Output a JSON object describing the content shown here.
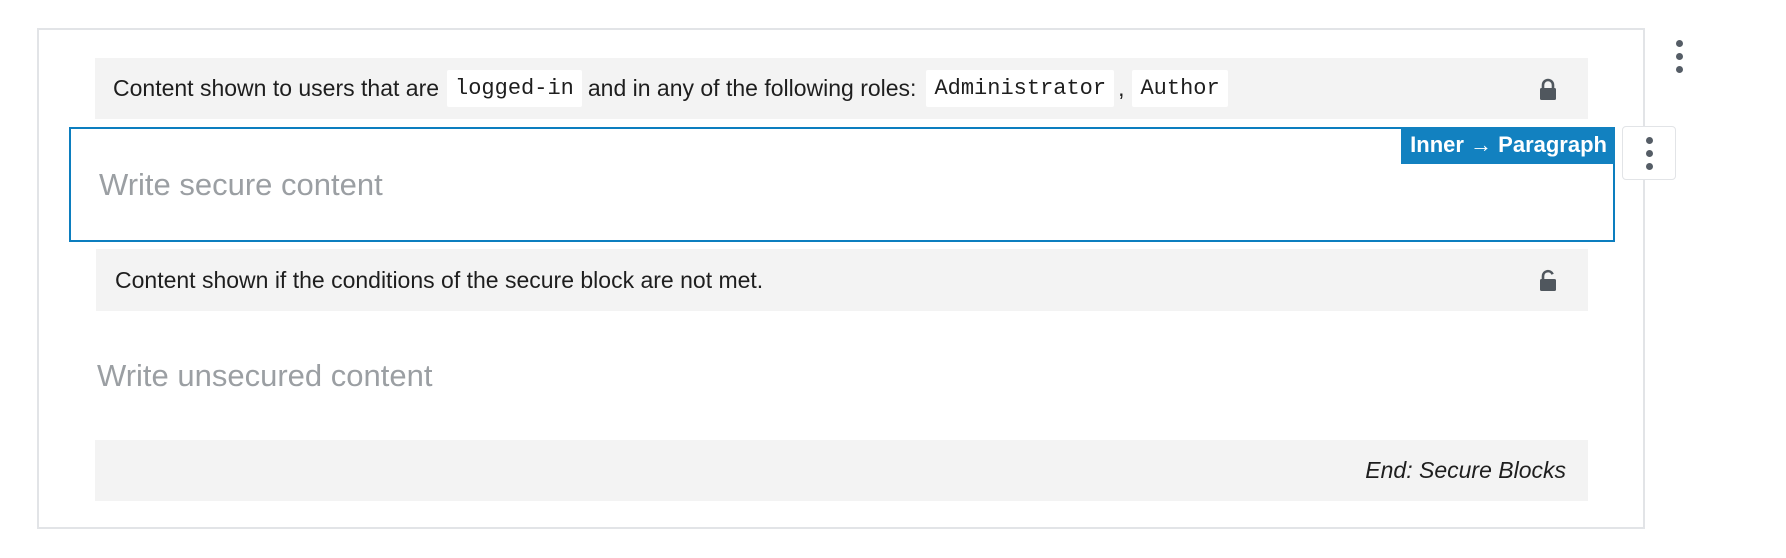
{
  "secure_block": {
    "conditions_bar": {
      "text_prefix": "Content shown to users that are",
      "status_code": "logged-in",
      "text_middle": "and in any of the following roles:",
      "roles": [
        "Administrator",
        "Author"
      ],
      "separator": ",",
      "icon": "lock-icon"
    },
    "inner_tag": "Inner → Paragraph",
    "secure_placeholder": "Write secure content",
    "fallback_bar": {
      "text": "Content shown if the conditions of the secure block are not met.",
      "icon": "unlock-icon"
    },
    "unsecured_placeholder": "Write unsecured content",
    "end_label": "End: Secure Blocks"
  },
  "colors": {
    "accent": "#0c7ebf",
    "tag_bg": "#1281c0",
    "bar_bg": "#f3f3f3",
    "placeholder": "#9b9fa3"
  }
}
